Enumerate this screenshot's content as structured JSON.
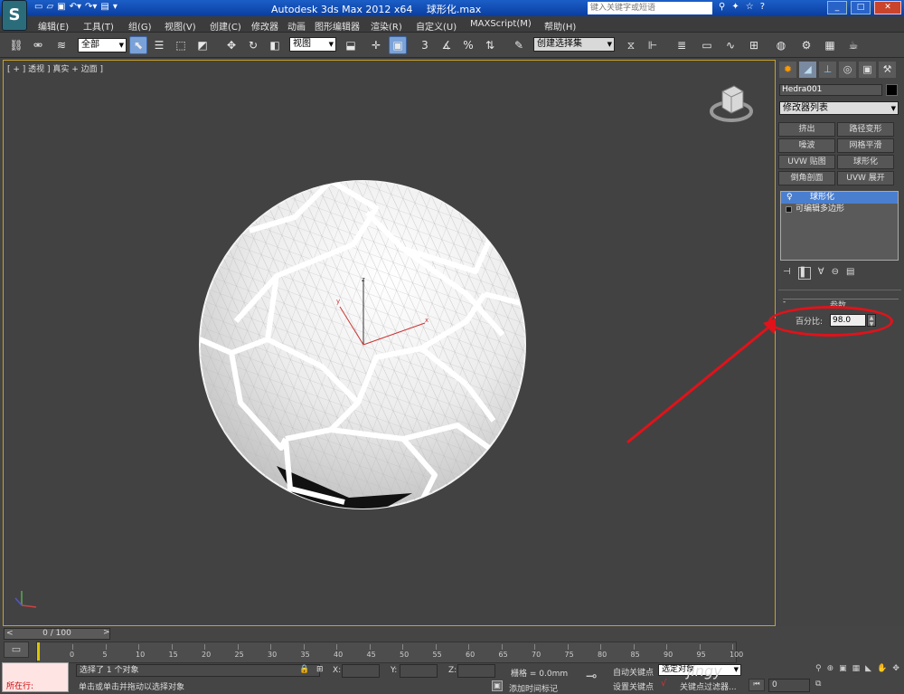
{
  "window": {
    "app_title": "Autodesk 3ds Max  2012 x64",
    "file_name": "球形化.max",
    "search_placeholder": "键入关键字或短语"
  },
  "menu": {
    "items": [
      "编辑(E)",
      "工具(T)",
      "组(G)",
      "视图(V)",
      "创建(C)",
      "修改器",
      "动画",
      "图形编辑器",
      "渲染(R)",
      "自定义(U)",
      "MAXScript(M)",
      "帮助(H)"
    ]
  },
  "toolbar": {
    "selection_filter": "全部",
    "ref_coord": "视图",
    "named_selection": "创建选择集"
  },
  "viewport": {
    "label": "[ + ] 透视 ] 真实 + 边面 ]",
    "gizmo": {
      "x": "x",
      "y": "y",
      "z": "z"
    }
  },
  "command_panel": {
    "object_name": "Hedra001",
    "modifier_list": "修改器列表",
    "modifier_buttons": [
      "挤出",
      "路径变形",
      "噪波",
      "网格平滑",
      "UVW 贴图",
      "球形化",
      "倒角剖面",
      "UVW 展开"
    ],
    "stack": [
      "球形化",
      "可编辑多边形"
    ],
    "rollout_title": "参数",
    "percent_label": "百分比:",
    "percent_value": "98.0"
  },
  "timeline": {
    "frame_display": "0 / 100",
    "ticks": [
      "0",
      "5",
      "10",
      "15",
      "20",
      "25",
      "30",
      "35",
      "40",
      "45",
      "50",
      "55",
      "60",
      "65",
      "70",
      "75",
      "80",
      "85",
      "90",
      "95",
      "100"
    ]
  },
  "status": {
    "script_label": "所在行:",
    "selection_status": "选择了 1 个对象",
    "prompt": "单击或单击并拖动以选择对象",
    "x_label": "X:",
    "y_label": "Y:",
    "z_label": "Z:",
    "grid": "栅格 = 0.0mm",
    "add_time_tag": "添加时间标记",
    "auto_key": "自动关键点",
    "set_key": "设置关键点",
    "selected_obj": "选定对象",
    "key_filters": "关键点过滤器...",
    "frame": "0",
    "watermark": "jingy"
  }
}
